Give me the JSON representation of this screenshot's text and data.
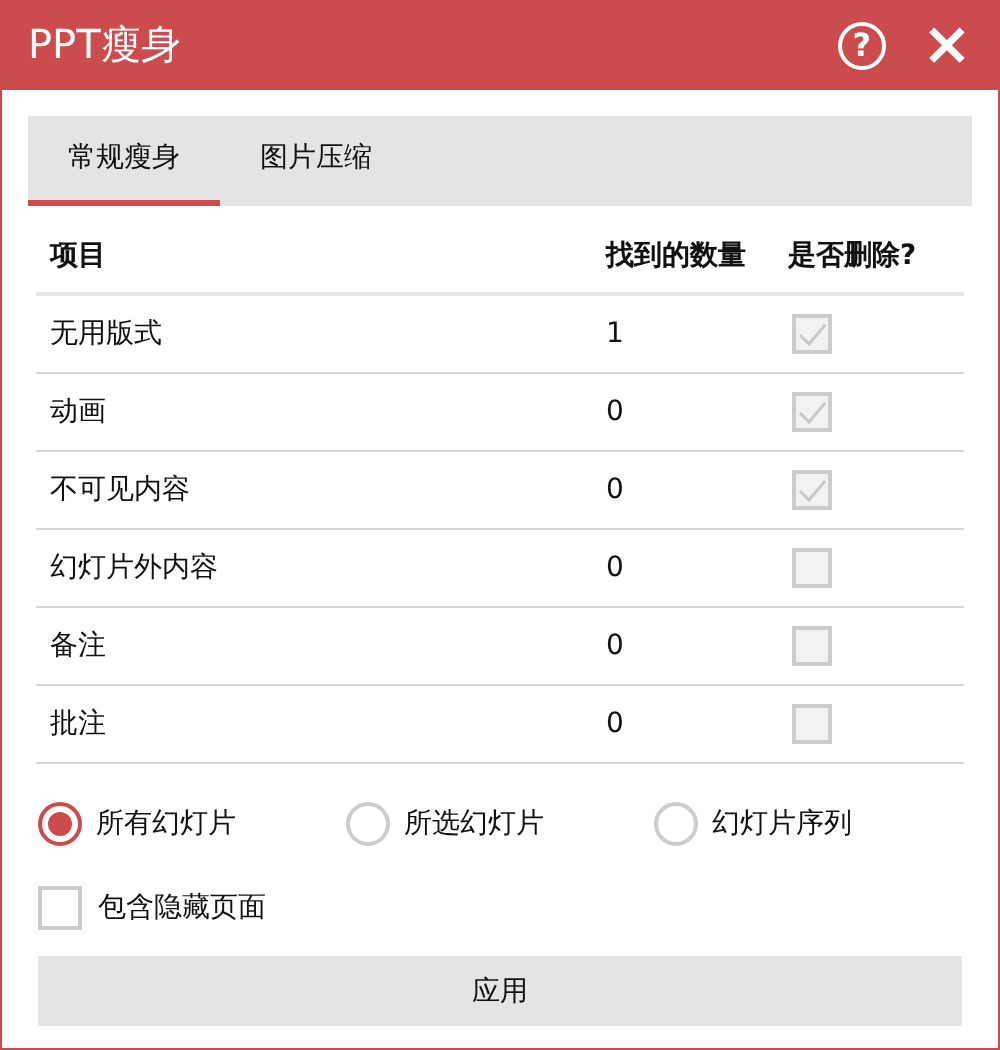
{
  "window": {
    "title": "PPT瘦身",
    "help": "?",
    "close": "×"
  },
  "tabs": [
    {
      "label": "常规瘦身",
      "selected": true
    },
    {
      "label": "图片压缩",
      "selected": false
    }
  ],
  "table": {
    "columns": [
      "项目",
      "找到的数量",
      "是否删除?"
    ],
    "rows": [
      {
        "name": "无用版式",
        "count": "1",
        "checked": true,
        "disabled": true
      },
      {
        "name": "动画",
        "count": "0",
        "checked": true,
        "disabled": true
      },
      {
        "name": "不可见内容",
        "count": "0",
        "checked": true,
        "disabled": true
      },
      {
        "name": "幻灯片外内容",
        "count": "0",
        "checked": false,
        "disabled": true
      },
      {
        "name": "备注",
        "count": "0",
        "checked": false,
        "disabled": true
      },
      {
        "name": "批注",
        "count": "0",
        "checked": false,
        "disabled": true
      }
    ]
  },
  "scope": [
    {
      "label": "所有幻灯片",
      "selected": true
    },
    {
      "label": "所选幻灯片",
      "selected": false
    },
    {
      "label": "幻灯片序列",
      "selected": false
    }
  ],
  "include_hidden": {
    "label": "包含隐藏页面",
    "checked": false
  },
  "apply_button": "应用"
}
